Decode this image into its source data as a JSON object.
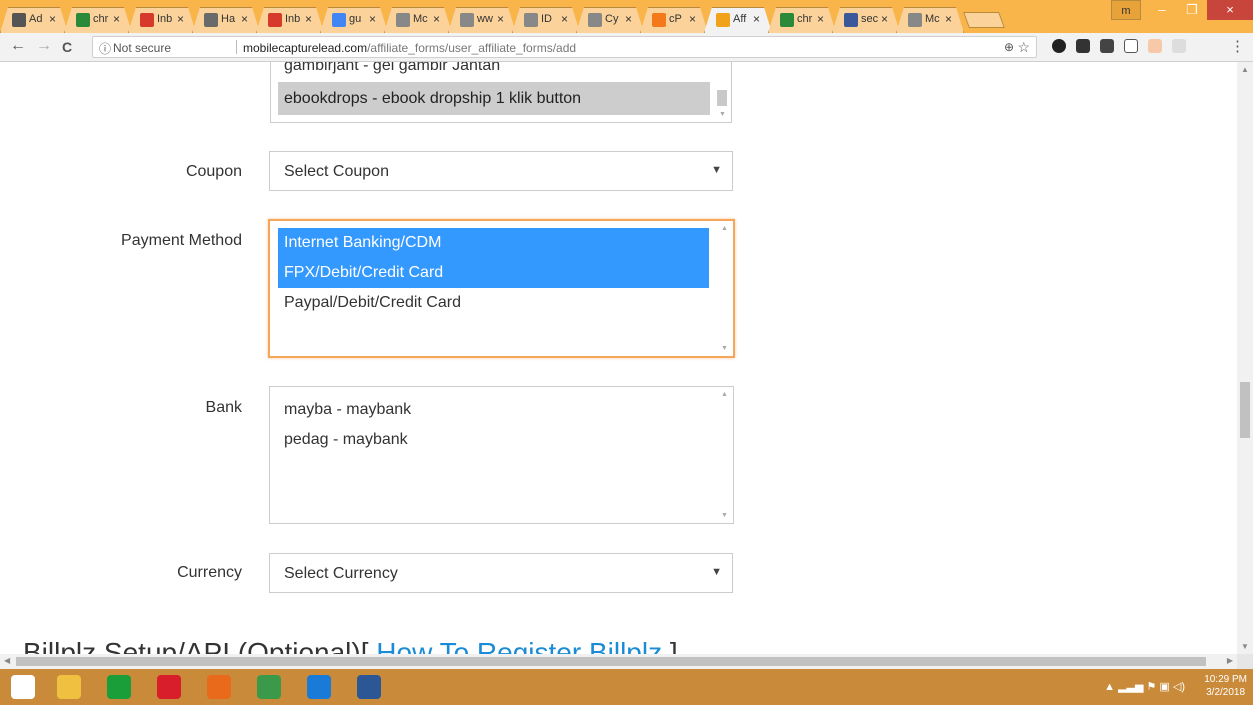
{
  "browser": {
    "tabs": [
      {
        "title": "Ad",
        "icon": "calendar-icon",
        "color": "#555555"
      },
      {
        "title": "chr",
        "icon": "chrome-icon",
        "color": "#2a8a3a"
      },
      {
        "title": "Inb",
        "icon": "gmail-icon",
        "color": "#d63a2a"
      },
      {
        "title": "Ha",
        "icon": "image-icon",
        "color": "#6a6a6a"
      },
      {
        "title": "Inb",
        "icon": "gmail-icon",
        "color": "#d63a2a"
      },
      {
        "title": "gu",
        "icon": "google-icon",
        "color": "#4285f4"
      },
      {
        "title": "Mc",
        "icon": "page-icon",
        "color": "#888888"
      },
      {
        "title": "ww",
        "icon": "page-icon",
        "color": "#888888"
      },
      {
        "title": "ID",
        "icon": "page-icon",
        "color": "#888888"
      },
      {
        "title": "Cy",
        "icon": "page-icon",
        "color": "#888888"
      },
      {
        "title": "cP",
        "icon": "cpanel-icon",
        "color": "#f27a1a"
      },
      {
        "title": "Aff",
        "icon": "affiliate-icon",
        "color": "#f2a21a",
        "active": true
      },
      {
        "title": "chr",
        "icon": "chrome-icon",
        "color": "#2a8a3a"
      },
      {
        "title": "sec",
        "icon": "facebook-icon",
        "color": "#3b5998"
      },
      {
        "title": "Mc",
        "icon": "page-icon",
        "color": "#888888"
      }
    ],
    "tab_close": "×",
    "user_button": "m",
    "window_controls": {
      "minimize": "–",
      "maximize": "❐",
      "close": "×"
    },
    "nav": {
      "back": "←",
      "forward": "→",
      "reload": "C"
    },
    "address": {
      "security_icon": "ⓘ",
      "security_text": "Not secure",
      "host": "mobilecapturelead.com",
      "path": "/affiliate_forms/user_affiliate_forms/add"
    },
    "zoom_icon": "⊕",
    "bookmark_icon": "☆",
    "menu": "⋮"
  },
  "form": {
    "product_list": {
      "options": [
        {
          "text": "gambirjant - gel gambir Jantan",
          "state": "normal"
        },
        {
          "text": "ebookdrops - ebook dropship 1 klik button",
          "state": "gray"
        }
      ]
    },
    "coupon": {
      "label": "Coupon",
      "value": "Select Coupon"
    },
    "payment_method": {
      "label": "Payment Method",
      "options": [
        {
          "text": "Internet Banking/CDM",
          "state": "selected"
        },
        {
          "text": "FPX/Debit/Credit Card",
          "state": "selected"
        },
        {
          "text": "Paypal/Debit/Credit Card",
          "state": "normal"
        }
      ]
    },
    "bank": {
      "label": "Bank",
      "options": [
        {
          "text": "mayba - maybank",
          "state": "normal"
        },
        {
          "text": "pedag - maybank",
          "state": "normal"
        }
      ]
    },
    "currency": {
      "label": "Currency",
      "value": "Select Currency"
    },
    "section_heading": {
      "text": "Billplz Setup/API (Optional)[ ",
      "link": "How To Register Billplz",
      "close": " ]"
    }
  },
  "taskbar": {
    "apps": [
      {
        "name": "start",
        "color": "#ffffff"
      },
      {
        "name": "file-explorer",
        "color": "#f0c040"
      },
      {
        "name": "store",
        "color": "#1a9e3a"
      },
      {
        "name": "opera",
        "color": "#d81e2a"
      },
      {
        "name": "firefox",
        "color": "#e86a1a"
      },
      {
        "name": "chrome",
        "color": "#3a9a4a"
      },
      {
        "name": "internet-explorer",
        "color": "#1a7ad8"
      },
      {
        "name": "word",
        "color": "#2b5797"
      }
    ],
    "time": "10:29 PM",
    "date": "3/2/2018"
  }
}
